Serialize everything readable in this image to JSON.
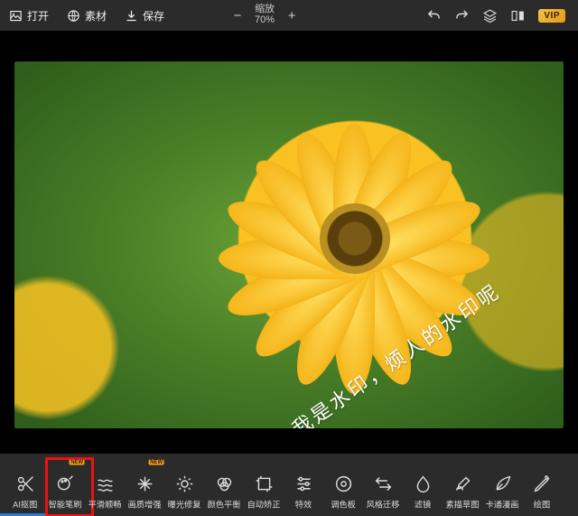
{
  "topbar": {
    "open": "打开",
    "assets": "素材",
    "save": "保存",
    "zoom_label": "缩放",
    "zoom_value": "70%",
    "zoom_minus": "−",
    "zoom_plus": "+",
    "vip": "VIP"
  },
  "watermark": "我是水印，烦人的水印呢",
  "badge": "NEW",
  "tools": [
    {
      "label": "AI抠图"
    },
    {
      "label": "智能笔刷"
    },
    {
      "label": "平滑顺畅"
    },
    {
      "label": "画质增强"
    },
    {
      "label": "曝光修复"
    },
    {
      "label": "颜色平衡"
    },
    {
      "label": "自动矫正"
    },
    {
      "label": "特效"
    },
    {
      "label": "调色板"
    },
    {
      "label": "风格迁移"
    },
    {
      "label": "滤镜"
    },
    {
      "label": "素描草图"
    },
    {
      "label": "卡通漫画"
    },
    {
      "label": "绘图"
    }
  ]
}
